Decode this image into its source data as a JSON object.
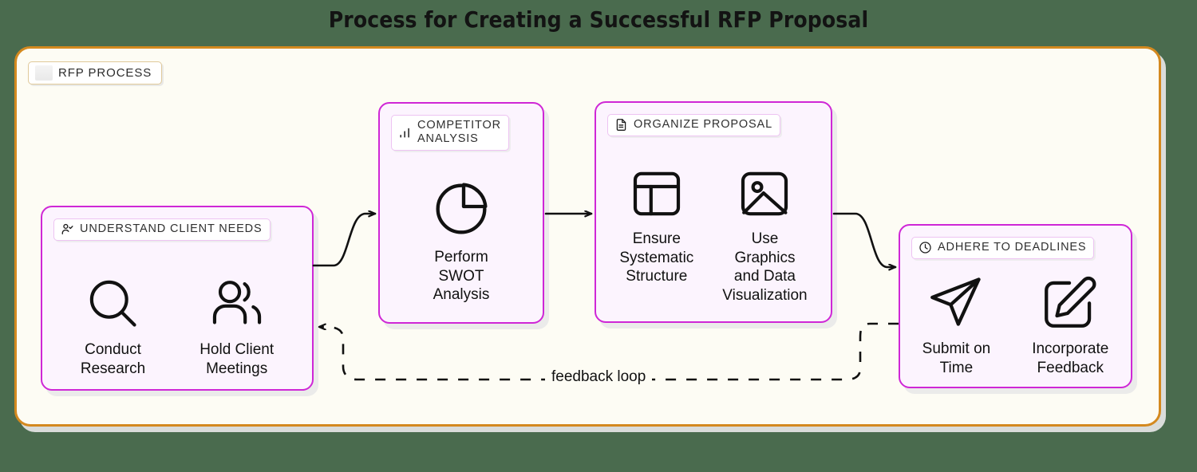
{
  "title": "Process for Creating a Successful RFP Proposal",
  "colors": {
    "page_background": "#4a6b4e",
    "container_border": "#d4891f",
    "container_fill": "#fdfcf4",
    "stage_border": "#cf27d6",
    "stage_fill": "#fcf4fe",
    "badge_border": "#edc3f2",
    "text": "#111111"
  },
  "container": {
    "badge_label": "RFP PROCESS",
    "badge_icon": "color-swatch-icon"
  },
  "stages": [
    {
      "id": "understand",
      "badge_label": "UNDERSTAND CLIENT NEEDS",
      "badge_icon": "user-check-icon",
      "items": [
        {
          "label": "Conduct\nResearch",
          "icon": "search-icon"
        },
        {
          "label": "Hold Client\nMeetings",
          "icon": "users-icon"
        }
      ]
    },
    {
      "id": "competitor",
      "badge_label": "COMPETITOR\nANALYSIS",
      "badge_icon": "bar-chart-icon",
      "items": [
        {
          "label": "Perform\nSWOT\nAnalysis",
          "icon": "pie-chart-icon"
        }
      ]
    },
    {
      "id": "organize",
      "badge_label": "ORGANIZE PROPOSAL",
      "badge_icon": "file-text-icon",
      "items": [
        {
          "label": "Ensure\nSystematic\nStructure",
          "icon": "layout-icon"
        },
        {
          "label": "Use\nGraphics\nand Data\nVisualization",
          "icon": "image-icon"
        }
      ]
    },
    {
      "id": "deadlines",
      "badge_label": "ADHERE TO DEADLINES",
      "badge_icon": "clock-icon",
      "items": [
        {
          "label": "Submit on\nTime",
          "icon": "send-icon"
        },
        {
          "label": "Incorporate\nFeedback",
          "icon": "edit-square-icon"
        }
      ]
    }
  ],
  "connectors": {
    "feedback_loop_label": "feedback loop"
  }
}
